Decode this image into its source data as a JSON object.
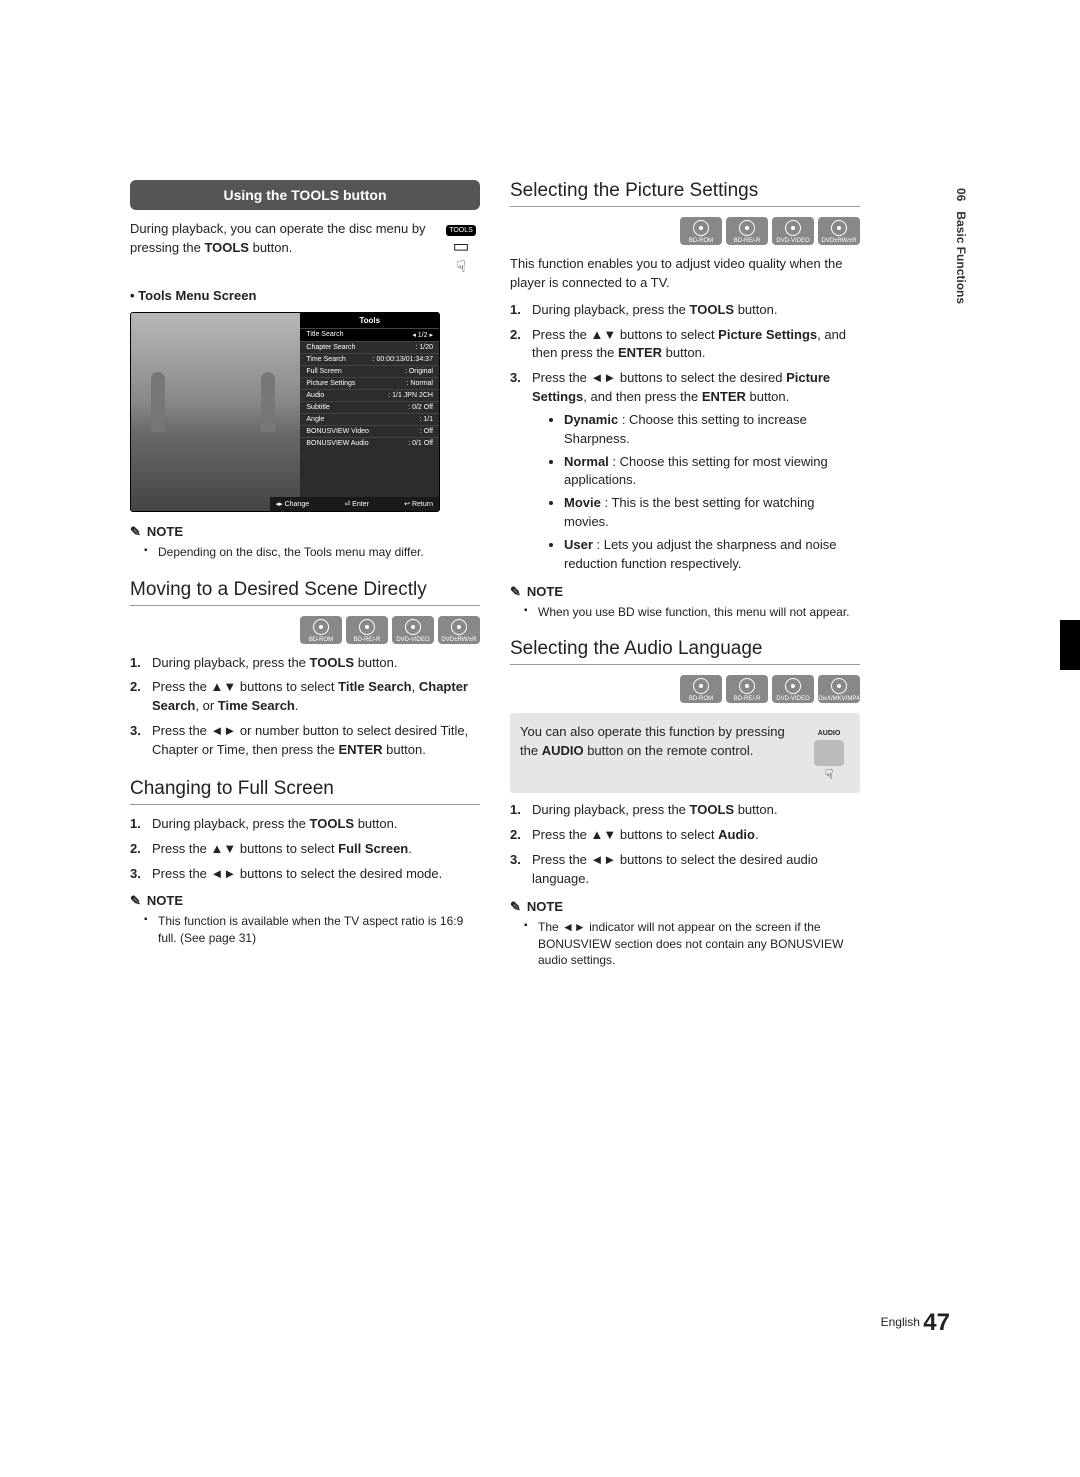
{
  "sidebar": {
    "chapter": "06",
    "chapter_title": "Basic Functions"
  },
  "left": {
    "sec1_header": "Using the TOOLS button",
    "sec1_para_a": "During playback, you can operate the disc menu by pressing the ",
    "sec1_para_b": "TOOLS",
    "sec1_para_c": " button.",
    "tools_btn_label": "TOOLS",
    "bullet1": "Tools Menu Screen",
    "tools_panel": {
      "title": "Tools",
      "rows": [
        {
          "label": "Title Search",
          "value": "1/2",
          "arrows": true
        },
        {
          "label": "Chapter Search",
          "value": "1/20"
        },
        {
          "label": "Time Search",
          "value": "00:00:13/01:34:37"
        },
        {
          "label": "Full Screen",
          "value": "Original"
        },
        {
          "label": "Picture Settings",
          "value": "Normal"
        },
        {
          "label": "Audio",
          "value": "1/1 JPN 2CH"
        },
        {
          "label": "Subtitle",
          "value": "0/2 Off"
        },
        {
          "label": "Angle",
          "value": "1/1"
        },
        {
          "label": "BONUSVIEW Video",
          "value": "Off"
        },
        {
          "label": "BONUSVIEW Audio",
          "value": "0/1 Off"
        }
      ],
      "footer": {
        "change": "◂▸ Change",
        "enter": "⏎ Enter",
        "return": "↩ Return"
      }
    },
    "note_label": "NOTE",
    "sec1_note1": "Depending on the disc, the Tools menu may differ.",
    "sec2_heading": "Moving to a Desired Scene Directly",
    "sec2_badges": [
      "BD-ROM",
      "BD-RE/-R",
      "DVD-VIDEO",
      "DVD±RW/±R"
    ],
    "sec2_step1_a": "During playback, press the ",
    "sec2_step1_b": "TOOLS",
    "sec2_step1_c": " button.",
    "sec2_step2_a": "Press the ▲▼ buttons to select ",
    "sec2_step2_b": "Title Search",
    "sec2_step2_c": ", ",
    "sec2_step2_d": "Chapter Search",
    "sec2_step2_e": ", or ",
    "sec2_step2_f": "Time Search",
    "sec2_step2_g": ".",
    "sec2_step3_a": "Press the ◄► or number button to select desired Title, Chapter or Time, then press the ",
    "sec2_step3_b": "ENTER",
    "sec2_step3_c": " button.",
    "sec3_heading": "Changing to Full Screen",
    "sec3_step1_a": "During playback, press the ",
    "sec3_step1_b": "TOOLS",
    "sec3_step1_c": " button.",
    "sec3_step2_a": "Press the ▲▼ buttons to select ",
    "sec3_step2_b": "Full Screen",
    "sec3_step2_c": ".",
    "sec3_step3": "Press the ◄► buttons to select the desired mode.",
    "sec3_note1": "This function is available when the TV aspect ratio is 16:9 full. (See page 31)"
  },
  "right": {
    "sec4_heading": "Selecting the Picture Settings",
    "sec4_badges": [
      "BD-ROM",
      "BD-RE/-R",
      "DVD-VIDEO",
      "DVD±RW/±R"
    ],
    "sec4_para": "This function enables you to adjust video quality when the player is connected to a TV.",
    "sec4_step1_a": "During playback, press the ",
    "sec4_step1_b": "TOOLS",
    "sec4_step1_c": " button.",
    "sec4_step2_a": "Press the ▲▼ buttons to select ",
    "sec4_step2_b": "Picture Settings",
    "sec4_step2_c": ", and then press the ",
    "sec4_step2_d": "ENTER",
    "sec4_step2_e": " button.",
    "sec4_step3_a": "Press the ◄► buttons to select the desired ",
    "sec4_step3_b": "Picture Settings",
    "sec4_step3_c": ", and then press the ",
    "sec4_step3_d": "ENTER",
    "sec4_step3_e": " button.",
    "sec4_opt1_a": "Dynamic",
    "sec4_opt1_b": " : Choose this setting to increase Sharpness.",
    "sec4_opt2_a": "Normal",
    "sec4_opt2_b": " : Choose this setting for most viewing applications.",
    "sec4_opt3_a": "Movie",
    "sec4_opt3_b": " : This is the best setting for watching movies.",
    "sec4_opt4_a": "User",
    "sec4_opt4_b": " : Lets you adjust the sharpness and noise reduction function respectively.",
    "sec4_note1": "When you use BD wise function, this menu will not appear.",
    "sec5_heading": "Selecting the Audio Language",
    "sec5_badges": [
      "BD-ROM",
      "BD-RE/-R",
      "DVD-VIDEO",
      "DivX/MKV/MP4"
    ],
    "sec5_box_a": "You can also operate this function by pressing the ",
    "sec5_box_b": "AUDIO",
    "sec5_box_c": " button on the remote control.",
    "audio_btn_label": "AUDIO",
    "sec5_step1_a": "During playback, press the ",
    "sec5_step1_b": "TOOLS",
    "sec5_step1_c": " button.",
    "sec5_step2_a": "Press the ▲▼ buttons to select ",
    "sec5_step2_b": "Audio",
    "sec5_step2_c": ".",
    "sec5_step3": "Press the ◄► buttons to select the desired audio language.",
    "sec5_note1": "The ◄► indicator will not appear on the screen if the BONUSVIEW section does not contain any BONUSVIEW audio settings."
  },
  "footer": {
    "lang": "English",
    "page": "47"
  }
}
